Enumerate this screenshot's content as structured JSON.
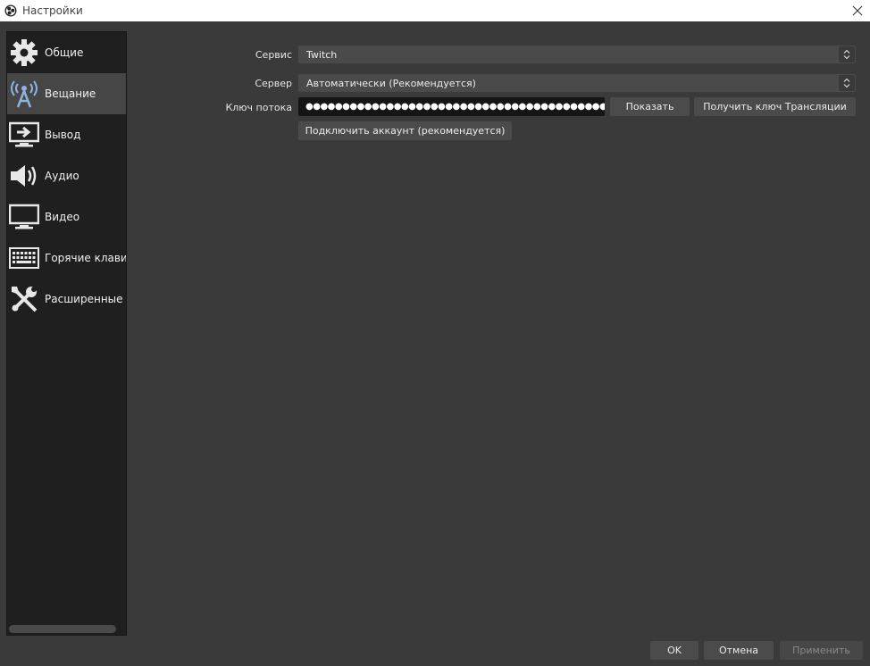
{
  "window": {
    "title": "Настройки"
  },
  "sidebar": {
    "items": [
      {
        "label": "Общие",
        "icon": "gear-icon"
      },
      {
        "label": "Вещание",
        "icon": "broadcast-antenna-icon",
        "active": true
      },
      {
        "label": "Вывод",
        "icon": "output-monitor-icon"
      },
      {
        "label": "Аудио",
        "icon": "speaker-icon"
      },
      {
        "label": "Видео",
        "icon": "monitor-icon"
      },
      {
        "label": "Горячие клавиш",
        "icon": "keyboard-icon"
      },
      {
        "label": "Расширенные",
        "icon": "tools-icon"
      }
    ]
  },
  "stream": {
    "service_label": "Сервис",
    "service_value": "Twitch",
    "server_label": "Сервер",
    "server_value": "Автоматически (Рекомендуется)",
    "key_label": "Ключ потока",
    "key_value": "●●●●●●●●●●●●●●●●●●●●●●●●●●●●●●●●●●●●●●●●●●●●●●",
    "show_button": "Показать",
    "get_key_button": "Получить ключ Трансляции",
    "connect_account_button": "Подключить аккаунт (рекомендуется)"
  },
  "footer": {
    "ok": "OK",
    "cancel": "Отмена",
    "apply": "Применить"
  }
}
